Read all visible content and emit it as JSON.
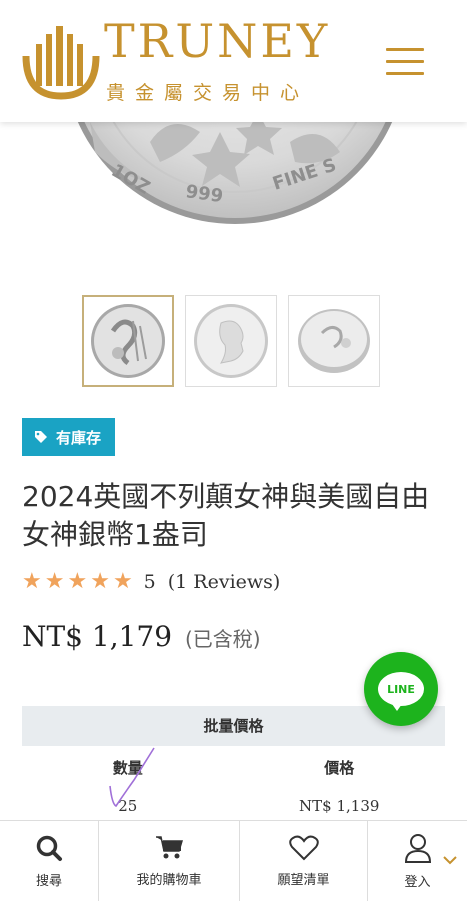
{
  "header": {
    "brand": "TRUNEY",
    "brand_sub": "貴金屬交易中心",
    "menu_icon": "hamburger-icon",
    "accent_color": "#c6922f"
  },
  "gallery": {
    "main_image_alt": "coin",
    "thumbnails": [
      {
        "name": "britannia-liberty-reverse",
        "active": true
      },
      {
        "name": "king-charles-obverse",
        "active": false
      },
      {
        "name": "coin-side-view",
        "active": false
      }
    ]
  },
  "product": {
    "stock_badge": "有庫存",
    "stock_icon": "tag-icon",
    "title": "2024英國不列顛女神與美國自由女神銀幣1盎司",
    "rating_value": "5",
    "rating_count": "(1 Reviews)",
    "stars": 5,
    "price": "NT$ 1,179",
    "tax_note": "(已含稅)"
  },
  "bulk_pricing": {
    "heading": "批量價格",
    "col_qty": "數量",
    "col_price": "價格",
    "rows": [
      {
        "qty": "25",
        "price": "NT$ 1,139"
      }
    ]
  },
  "line_button": {
    "label": "LINE",
    "color": "#1db31d"
  },
  "bottom_nav": {
    "items": [
      {
        "label": "搜尋",
        "icon": "search-icon"
      },
      {
        "label": "我的購物車",
        "icon": "cart-icon"
      },
      {
        "label": "願望清單",
        "icon": "heart-icon"
      },
      {
        "label": "登入",
        "icon": "user-icon"
      }
    ]
  },
  "coin_inscriptions": {
    "weight": "1OZ",
    "fineness": "999",
    "fine": "FINE S"
  }
}
